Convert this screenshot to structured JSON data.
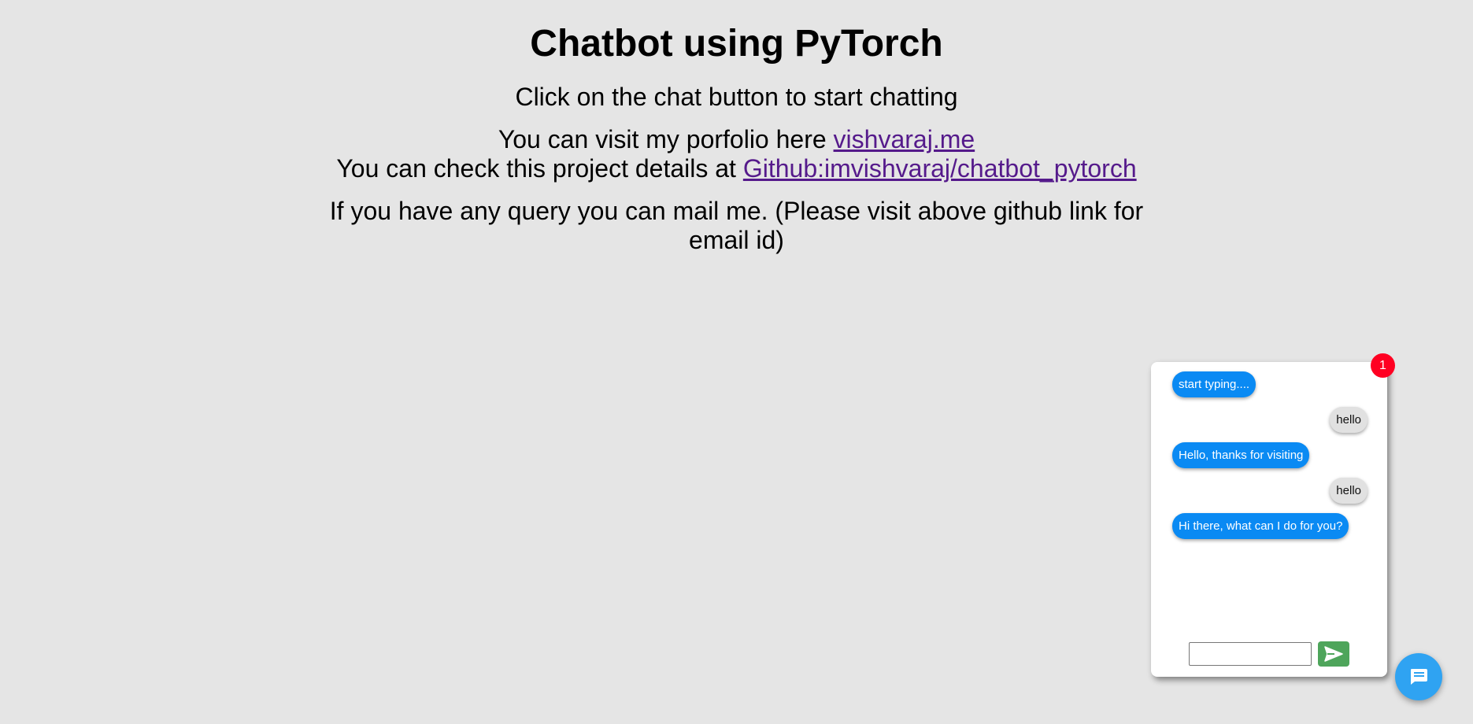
{
  "header": {
    "title": "Chatbot using PyTorch",
    "instruction": "Click on the chat button to start chatting"
  },
  "links": {
    "portfolio_prefix": "You can visit my porfolio here ",
    "portfolio_link": "vishvaraj.me",
    "github_prefix": "You can check this project details at ",
    "github_link": "Github:imvishvaraj/chatbot_pytorch"
  },
  "query_text": "If you have any query you can mail me. (Please visit above github link for email id)",
  "chat": {
    "badge_count": "1",
    "messages": [
      {
        "sender": "bot",
        "text": "start typing...."
      },
      {
        "sender": "user",
        "text": "hello"
      },
      {
        "sender": "bot",
        "text": "Hello, thanks for visiting"
      },
      {
        "sender": "user",
        "text": "hello"
      },
      {
        "sender": "bot",
        "text": "Hi there, what can I do for you?"
      }
    ],
    "input_value": "",
    "send_icon": "send-icon",
    "fab_icon": "chat-icon"
  },
  "colors": {
    "background": "#e5e5e5",
    "bot_bubble": "#0a8af3",
    "user_bubble": "#e1e1e1",
    "badge": "#ff0022",
    "send_button": "#4ea55b",
    "fab": "#2fa3f2",
    "link": "#551a8b"
  }
}
